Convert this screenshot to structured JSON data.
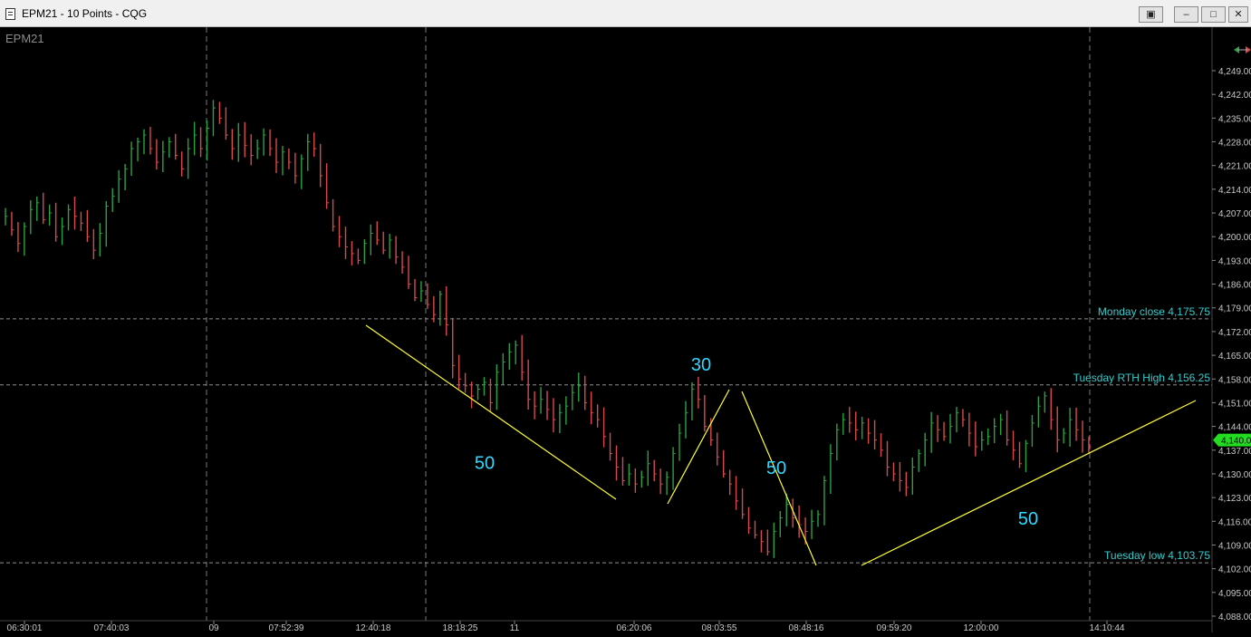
{
  "window": {
    "title": "EPM21 - 10 Points - CQG",
    "buttons": {
      "restore_icon": "▣",
      "minimize": "–",
      "maximize": "□",
      "close": "✕"
    }
  },
  "colors": {
    "background": "#000000",
    "price_bars": "#d94a4a",
    "price_bars_up": "#2ea043",
    "annotation_lines": "#ffff33",
    "annotation_text": "#33d6ff",
    "level_label": "#33cccc",
    "axis_text": "#c8c8c8",
    "grid": "#7a7a7a",
    "last_price_tag": "#22dd22"
  },
  "chart_data": {
    "type": "bar",
    "symbol": "EPM21",
    "interval": "10 Points",
    "y_ticks": [
      "4,249.00",
      "4,242.00",
      "4,235.00",
      "4,228.00",
      "4,221.00",
      "4,214.00",
      "4,207.00",
      "4,200.00",
      "4,193.00",
      "4,186.00",
      "4,179.00",
      "4,172.00",
      "4,165.00",
      "4,158.00",
      "4,151.00",
      "4,144.00",
      "4,137.00",
      "4,130.00",
      "4,123.00",
      "4,116.00",
      "4,109.00",
      "4,102.00",
      "4,095.00",
      "4,088.00"
    ],
    "ylim": [
      4086.5,
      4254
    ],
    "x_ticks": [
      "06:30:01",
      "07:40:03",
      "09",
      "07:52:39",
      "12:40:18",
      "18:18:25",
      "11",
      "06:20:06",
      "08:03:55",
      "08:48:16",
      "09:59:20",
      "12:00:00",
      "14:10:44"
    ],
    "last_price": "4,140.00",
    "levels": [
      {
        "label": "Monday close 4,175.75",
        "value": 4175.75
      },
      {
        "label": "Tuesday RTH High 4,156.25",
        "value": 4156.25
      },
      {
        "label": "Tuesday low 4,103.75",
        "value": 4103.75
      }
    ],
    "closes": [
      4206,
      4202,
      4198,
      4203,
      4208,
      4210,
      4205,
      4207,
      4200,
      4203,
      4208,
      4206,
      4204,
      4200,
      4196,
      4201,
      4209,
      4212,
      4217,
      4220,
      4226,
      4228,
      4230,
      4226,
      4222,
      4225,
      4228,
      4224,
      4220,
      4226,
      4230,
      4226,
      4232,
      4238,
      4235,
      4230,
      4226,
      4230,
      4227,
      4224,
      4226,
      4230,
      4226,
      4222,
      4225,
      4222,
      4218,
      4223,
      4228,
      4226,
      4218,
      4210,
      4203,
      4200,
      4197,
      4195,
      4193,
      4198,
      4201,
      4199,
      4196,
      4199,
      4194,
      4191,
      4186,
      4182,
      4184,
      4180,
      4177,
      4183,
      4174,
      4162,
      4158,
      4156,
      4153,
      4155,
      4157,
      4151,
      4160,
      4163,
      4166,
      4168,
      4160,
      4152,
      4150,
      4152,
      4149,
      4146,
      4148,
      4150,
      4154,
      4156,
      4151,
      4148,
      4146,
      4141,
      4136,
      4132,
      4128,
      4130,
      4127,
      4129,
      4133,
      4130,
      4127,
      4129,
      4136,
      4142,
      4148,
      4155,
      4152,
      4144,
      4140,
      4135,
      4130,
      4127,
      4122,
      4118,
      4114,
      4112,
      4110,
      4107,
      4113,
      4117,
      4121,
      4117,
      4115,
      4113,
      4116,
      4118,
      4128,
      4136,
      4143,
      4146,
      4145,
      4143,
      4145,
      4142,
      4140,
      4137,
      4132,
      4130,
      4128,
      4126,
      4132,
      4136,
      4140,
      4145,
      4143,
      4141,
      4144,
      4148,
      4146,
      4142,
      4138,
      4140,
      4141,
      4144,
      4146,
      4140,
      4137,
      4133,
      4139,
      4145,
      4150,
      4153,
      4146,
      4140,
      4142,
      4146,
      4143,
      4140,
      4138
    ]
  },
  "annotations": [
    {
      "text": "50",
      "value": 4131.5
    },
    {
      "text": "30",
      "value": 4160.5
    },
    {
      "text": "50",
      "value": 4130
    },
    {
      "text": "50",
      "value": 4115
    }
  ]
}
